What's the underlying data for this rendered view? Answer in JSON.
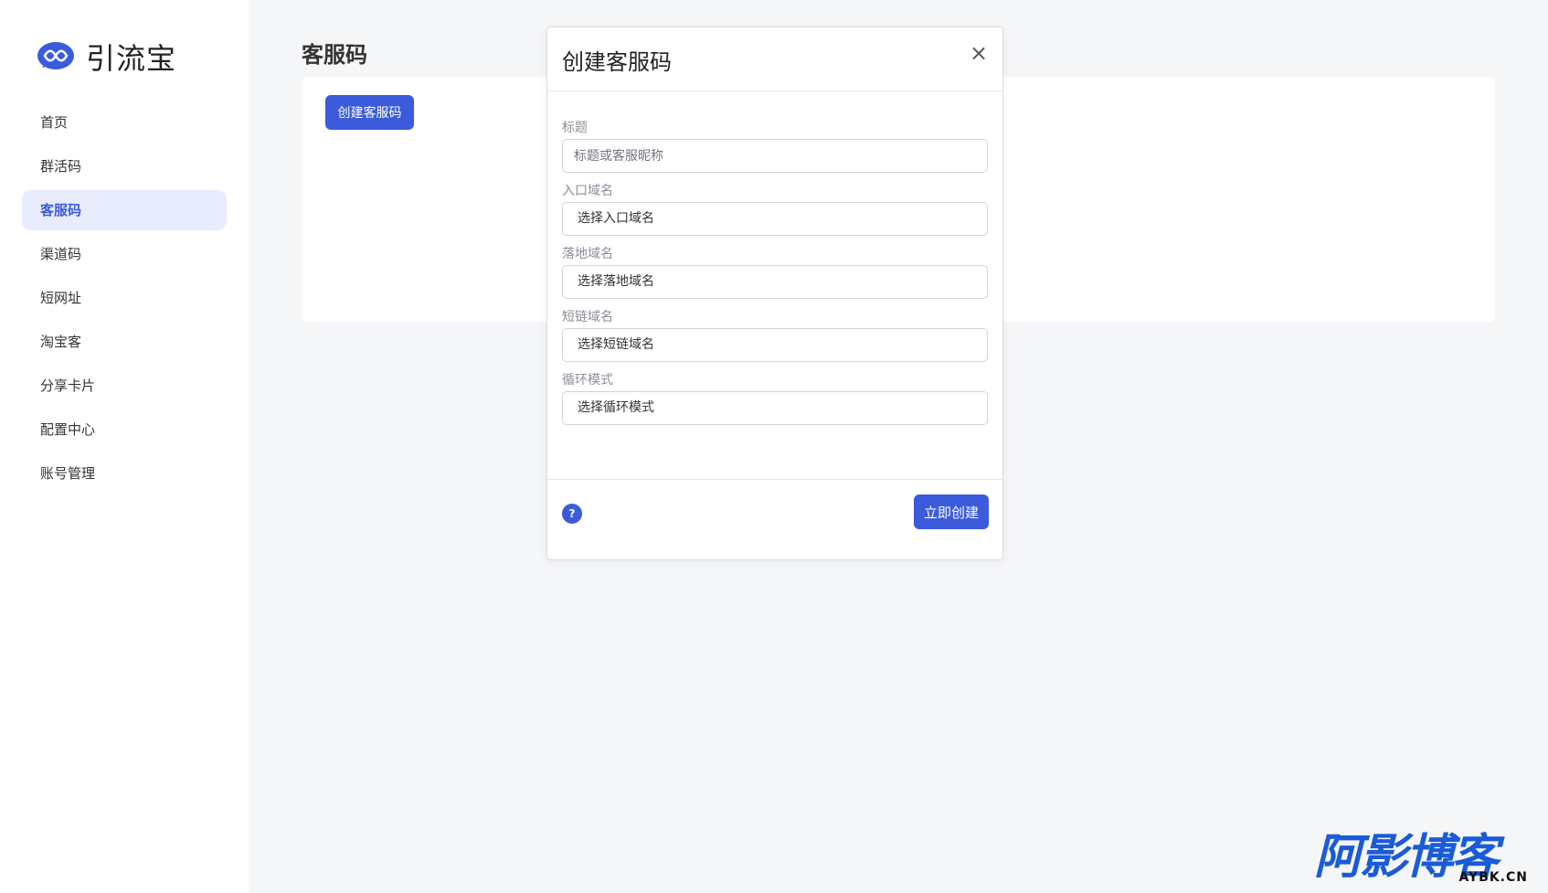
{
  "brand": {
    "name": "引流宝",
    "logo_icon": "infinity-bubble-icon",
    "color": "#3b5bdb"
  },
  "sidebar": {
    "items": [
      {
        "label": "首页",
        "active": false
      },
      {
        "label": "群活码",
        "active": false
      },
      {
        "label": "客服码",
        "active": true
      },
      {
        "label": "渠道码",
        "active": false
      },
      {
        "label": "短网址",
        "active": false
      },
      {
        "label": "淘宝客",
        "active": false
      },
      {
        "label": "分享卡片",
        "active": false
      },
      {
        "label": "配置中心",
        "active": false
      },
      {
        "label": "账号管理",
        "active": false
      }
    ]
  },
  "main": {
    "title": "客服码",
    "create_button": "创建客服码"
  },
  "modal": {
    "title": "创建客服码",
    "close_icon": "close-icon",
    "fields": [
      {
        "label": "标题",
        "type": "input",
        "placeholder": "标题或客服昵称",
        "value": ""
      },
      {
        "label": "入口域名",
        "type": "select",
        "value": "选择入口域名"
      },
      {
        "label": "落地域名",
        "type": "select",
        "value": "选择落地域名"
      },
      {
        "label": "短链域名",
        "type": "select",
        "value": "选择短链域名"
      },
      {
        "label": "循环模式",
        "type": "select",
        "value": "选择循环模式"
      }
    ],
    "help_icon": "question-circle-icon",
    "help_glyph": "?",
    "submit_button": "立即创建"
  },
  "watermark": {
    "main": "阿影博客",
    "sub": "AYBK.CN",
    "color": "#1a5bd8"
  }
}
